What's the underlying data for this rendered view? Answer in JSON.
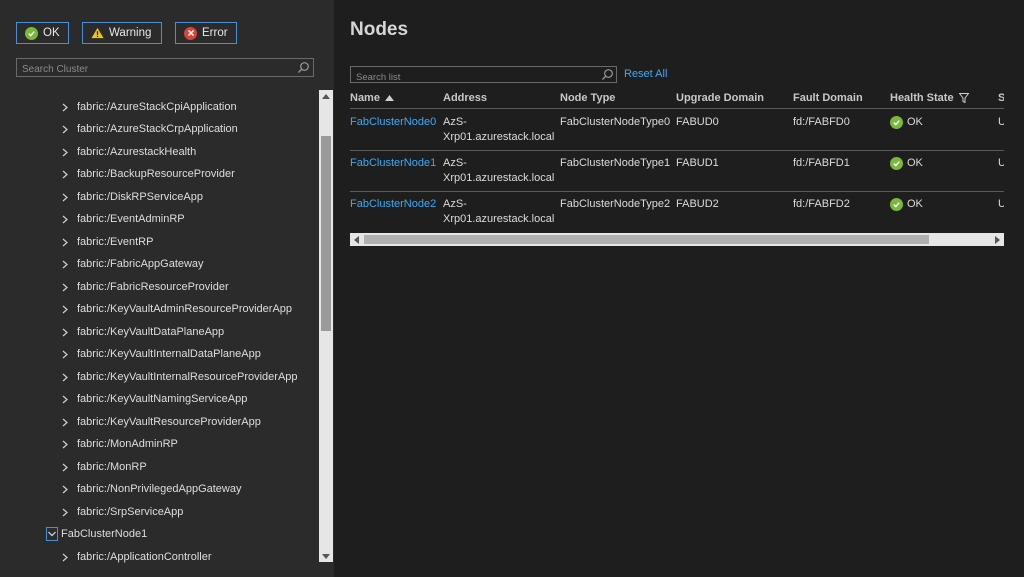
{
  "filters": {
    "ok": "OK",
    "warning": "Warning",
    "error": "Error"
  },
  "cluster_search": {
    "placeholder": "Search Cluster"
  },
  "tree": {
    "items": [
      "fabric:/AzureStackCpiApplication",
      "fabric:/AzureStackCrpApplication",
      "fabric:/AzurestackHealth",
      "fabric:/BackupResourceProvider",
      "fabric:/DiskRPServiceApp",
      "fabric:/EventAdminRP",
      "fabric:/EventRP",
      "fabric:/FabricAppGateway",
      "fabric:/FabricResourceProvider",
      "fabric:/KeyVaultAdminResourceProviderApp",
      "fabric:/KeyVaultDataPlaneApp",
      "fabric:/KeyVaultInternalDataPlaneApp",
      "fabric:/KeyVaultInternalResourceProviderApp",
      "fabric:/KeyVaultNamingServiceApp",
      "fabric:/KeyVaultResourceProviderApp",
      "fabric:/MonAdminRP",
      "fabric:/MonRP",
      "fabric:/NonPrivilegedAppGateway",
      "fabric:/SrpServiceApp"
    ],
    "expanded_node": "FabClusterNode1",
    "child_items": [
      "fabric:/ApplicationController"
    ]
  },
  "main": {
    "title": "Nodes",
    "search": {
      "placeholder": "Search list"
    },
    "reset_all": "Reset All",
    "columns": [
      "Name",
      "Address",
      "Node Type",
      "Upgrade Domain",
      "Fault Domain",
      "Health State",
      "S"
    ],
    "rows": [
      {
        "name": "FabClusterNode0",
        "address_line1": "AzS-",
        "address_line2": "Xrp01.azurestack.local",
        "node_type": "FabClusterNodeType0",
        "upgrade_domain": "FABUD0",
        "fault_domain": "fd:/FABFD0",
        "health": "OK",
        "extra": "U"
      },
      {
        "name": "FabClusterNode1",
        "address_line1": "AzS-",
        "address_line2": "Xrp01.azurestack.local",
        "node_type": "FabClusterNodeType1",
        "upgrade_domain": "FABUD1",
        "fault_domain": "fd:/FABFD1",
        "health": "OK",
        "extra": "U"
      },
      {
        "name": "FabClusterNode2",
        "address_line1": "AzS-",
        "address_line2": "Xrp01.azurestack.local",
        "node_type": "FabClusterNodeType2",
        "upgrade_domain": "FABUD2",
        "fault_domain": "fd:/FABFD2",
        "health": "OK",
        "extra": "U"
      }
    ]
  },
  "colors": {
    "accent": "#3fa9f5",
    "ok": "#7ab83a",
    "warning": "#f0c419",
    "error": "#d8433a"
  }
}
